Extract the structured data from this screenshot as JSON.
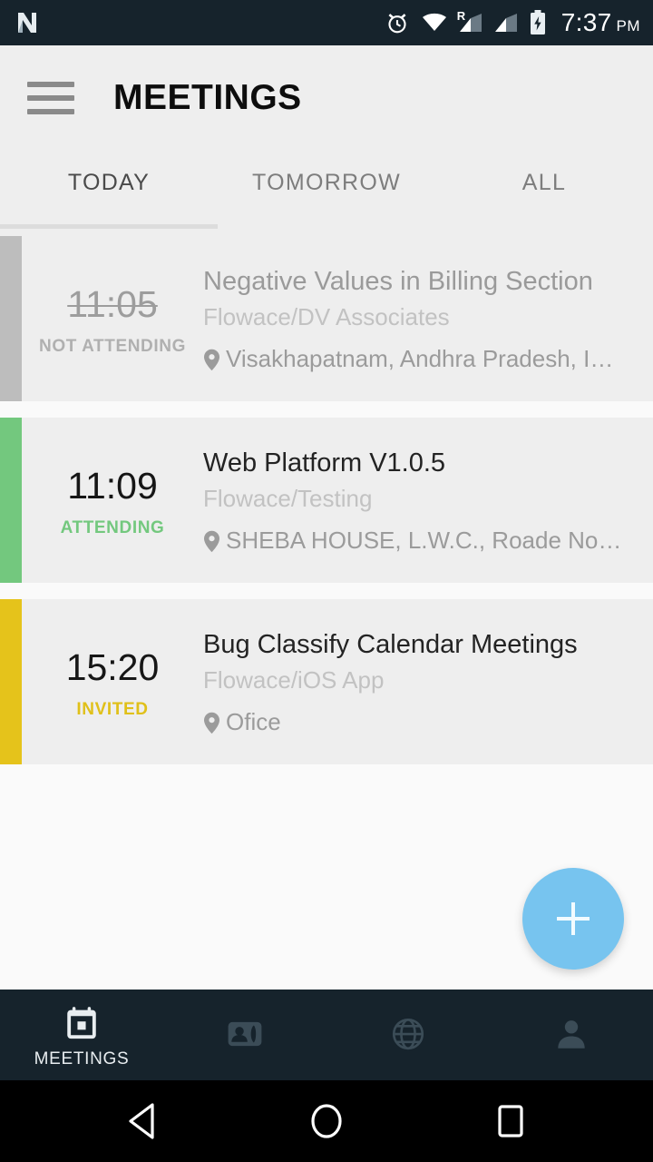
{
  "statusbar": {
    "left_icon": "android-n-logo",
    "icons": [
      "alarm-icon",
      "wifi-icon",
      "signal-roaming-icon",
      "signal-icon",
      "battery-charging-icon"
    ],
    "roaming_badge": "R",
    "time": "7:37",
    "ampm": "PM"
  },
  "appbar": {
    "menu_icon": "hamburger-menu-icon",
    "title": "MEETINGS"
  },
  "tabs": {
    "items": [
      {
        "label": "TODAY",
        "active": true
      },
      {
        "label": "TOMORROW",
        "active": false
      },
      {
        "label": "ALL",
        "active": false
      }
    ],
    "indicator_color": "#dcdcdc"
  },
  "meetings": [
    {
      "time": "11:05",
      "time_struck": true,
      "status": "NOT ATTENDING",
      "status_color": "#b0b0b0",
      "accent_color": "#bdbdbd",
      "title": "Negative Values in Billing Section",
      "title_dim": true,
      "project": "Flowace/DV Associates",
      "location": "Visakhapatnam, Andhra Pradesh, I…"
    },
    {
      "time": "11:09",
      "time_struck": false,
      "status": "ATTENDING",
      "status_color": "#73c87e",
      "accent_color": "#73c87e",
      "title": "Web Platform V1.0.5",
      "title_dim": false,
      "project": "Flowace/Testing",
      "location": "SHEBA HOUSE, L.W.C., Roade No…"
    },
    {
      "time": "15:20",
      "time_struck": false,
      "status": "INVITED",
      "status_color": "#e0c019",
      "accent_color": "#e5c31b",
      "title": "Bug Classify Calendar Meetings",
      "title_dim": false,
      "project": "Flowace/iOS App",
      "location": "Ofice"
    }
  ],
  "fab": {
    "icon": "plus-icon",
    "color": "#77c4ef",
    "label": "Add meeting"
  },
  "bottomnav": {
    "items": [
      {
        "icon": "calendar-icon",
        "label": "MEETINGS",
        "active": true
      },
      {
        "icon": "contacts-phone-icon",
        "label": "",
        "active": false
      },
      {
        "icon": "globe-icon",
        "label": "",
        "active": false
      },
      {
        "icon": "person-icon",
        "label": "",
        "active": false
      }
    ],
    "active_color": "#e8edf0",
    "inactive_color": "#3b4c57"
  },
  "androidnav": {
    "back": "back-triangle-icon",
    "home": "home-circle-icon",
    "recents": "recents-square-icon"
  }
}
